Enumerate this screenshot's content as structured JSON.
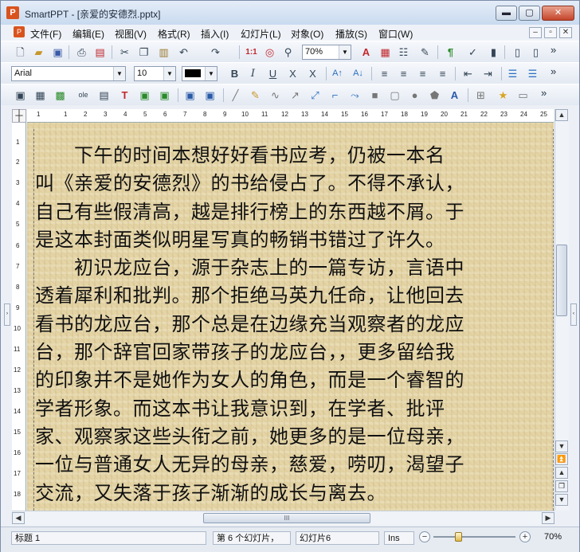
{
  "app": {
    "title": "SmartPPT - [亲爱的安德烈.pptx]",
    "icon_letter": "P"
  },
  "window_buttons": {
    "minimize": "▬",
    "maximize": "▢",
    "close": "✕"
  },
  "menu": {
    "items": [
      "文件(F)",
      "编辑(E)",
      "视图(V)",
      "格式(R)",
      "插入(I)",
      "幻灯片(L)",
      "对象(O)",
      "播放(S)",
      "窗口(W)"
    ],
    "mdi_buttons": [
      "–",
      "▫",
      "✕"
    ]
  },
  "standard_toolbar": {
    "zoom_value": "70%",
    "icons": [
      "new-doc",
      "open-folder",
      "save",
      "print",
      "pdf",
      "cut",
      "copy",
      "paste",
      "undo",
      "redo",
      "date-insert",
      "find",
      "zoom",
      "zoom-select",
      "text-a",
      "note",
      "list",
      "brush",
      "paragraph",
      "spell",
      "chart",
      "fill",
      "picture",
      "more"
    ]
  },
  "format_toolbar": {
    "font_name": "Arial",
    "font_size": "10",
    "text_color": "#000000",
    "buttons": [
      "B",
      "I",
      "U",
      "X",
      "X",
      "A↑",
      "A↓",
      "≡",
      "≡",
      "≡",
      "≡",
      "⇤",
      "⇥",
      "☰",
      "☰"
    ]
  },
  "drawing_toolbar": {
    "icons": [
      "slide-layout",
      "table",
      "image",
      "ole",
      "textbox",
      "title",
      "frame-a",
      "frame-b",
      "group",
      "ungroup",
      "line",
      "pen",
      "curve",
      "arrow",
      "connector-a",
      "connector-b",
      "connector-c",
      "rectangle",
      "rounded-rect",
      "ellipse",
      "shape",
      "wordart",
      "align",
      "star",
      "callout"
    ]
  },
  "ruler": {
    "h_ticks": [
      "1",
      "2",
      "1",
      "2",
      "3",
      "4",
      "5",
      "6",
      "7",
      "8",
      "9",
      "10",
      "11",
      "12",
      "13",
      "14",
      "15",
      "16",
      "17",
      "18",
      "19",
      "20",
      "21",
      "22",
      "23",
      "24",
      "25"
    ],
    "v_ticks": [
      "1",
      "2",
      "3",
      "4",
      "5",
      "6",
      "7",
      "8",
      "9",
      "10",
      "11",
      "12",
      "13",
      "14",
      "15",
      "16",
      "17",
      "18"
    ]
  },
  "slide": {
    "lines": [
      "　　下午的时间本想好好看书应考，仍被一本名",
      "叫《亲爱的安德烈》的书给侵占了。不得不承认，",
      "自己有些假清高，越是排行榜上的东西越不屑。于",
      "是这本封面类似明星写真的畅销书错过了许久。",
      "　　初识龙应台，源于杂志上的一篇专访，言语中",
      "透着犀利和批判。那个拒绝马英九任命，让他回去",
      "看书的龙应台，那个总是在边缘充当观察者的龙应",
      "台，那个辞官回家带孩子的龙应台，，更多留给我",
      "的印象并不是她作为女人的角色，而是一个睿智的",
      "学者形象。而这本书让我意识到，在学者、批评",
      "家、观察家这些头衔之前，她更多的是一位母亲，",
      "一位与普通女人无异的母亲，慈爱，唠叨，渴望子",
      "交流，又失落于孩子渐渐的成长与离去。"
    ]
  },
  "scroll": {
    "hthumb_label": "III",
    "up": "▲",
    "down": "▼",
    "left": "◀",
    "right": "▶"
  },
  "status": {
    "layout": "标题 1",
    "slide_count": "第 6 个幻灯片，",
    "slide_name": "幻灯片6",
    "mode": "Ins",
    "zoom_label": "70%",
    "zoom_level_fraction": 0.35
  }
}
